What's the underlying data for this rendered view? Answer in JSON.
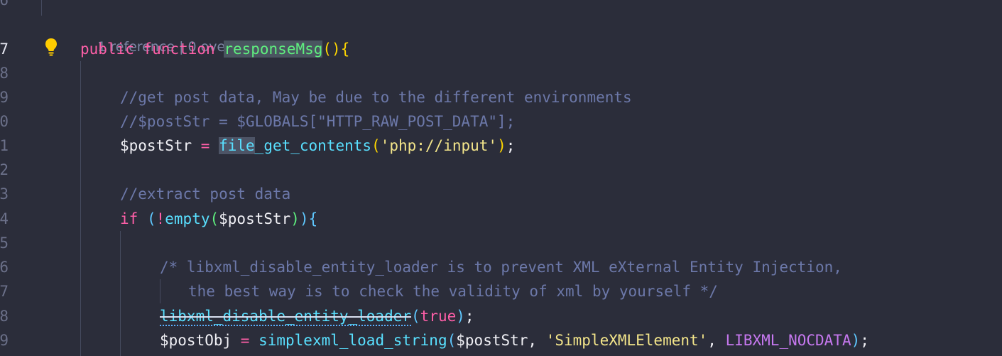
{
  "codelens": {
    "references": "1 reference",
    "separator": " | ",
    "overrides": "0 overrides"
  },
  "line_numbers": [
    "6",
    "7",
    "8",
    "9",
    "0",
    "1",
    "2",
    "3",
    "4",
    "5",
    "6",
    "7",
    "8",
    "9"
  ],
  "code": {
    "l7": {
      "kw1": "public",
      "kw2": "function",
      "name": "responseMsg",
      "parens": "()",
      "brace": "{"
    },
    "l9": {
      "comment": "//get post data, May be due to the different environments"
    },
    "l10": {
      "comment": "//$postStr = $GLOBALS[\"HTTP_RAW_POST_DATA\"];"
    },
    "l11": {
      "var": "$postStr",
      "eq": " = ",
      "fn_a": "file",
      "fn_b": "_get_contents",
      "open": "(",
      "str": "'php://input'",
      "close": ")",
      "semi": ";"
    },
    "l13": {
      "comment": "//extract post data"
    },
    "l14": {
      "kw": "if",
      "sp": " ",
      "open": "(",
      "bang": "!",
      "fn": "empty",
      "open2": "(",
      "var": "$postStr",
      "close2": ")",
      "close": ")",
      "brace": "{"
    },
    "l16": {
      "comment": "/* libxml_disable_entity_loader is to prevent XML eXternal Entity Injection,"
    },
    "l17": {
      "comment": "the best way is to check the validity of xml by yourself */"
    },
    "l18": {
      "fn": "libxml_disable_entity_loader",
      "open": "(",
      "kw": "true",
      "close": ")",
      "semi": ";"
    },
    "l19": {
      "var": "$postObj",
      "eq": " = ",
      "fn": "simplexml_load_string",
      "open": "(",
      "arg1": "$postStr",
      "comma1": ", ",
      "str": "'SimpleXMLElement'",
      "comma2": ", ",
      "const": "LIBXML_NOCDATA",
      "close": ")",
      "semi": ";"
    }
  },
  "colors": {
    "background": "#2b2d3a",
    "keyword": "#ff5fa8",
    "function": "#59e0ff",
    "comment": "#6c78a9",
    "string": "#f3e58a",
    "constant": "#c678ef"
  },
  "icons": {
    "lightbulb": "lightbulb-icon"
  }
}
